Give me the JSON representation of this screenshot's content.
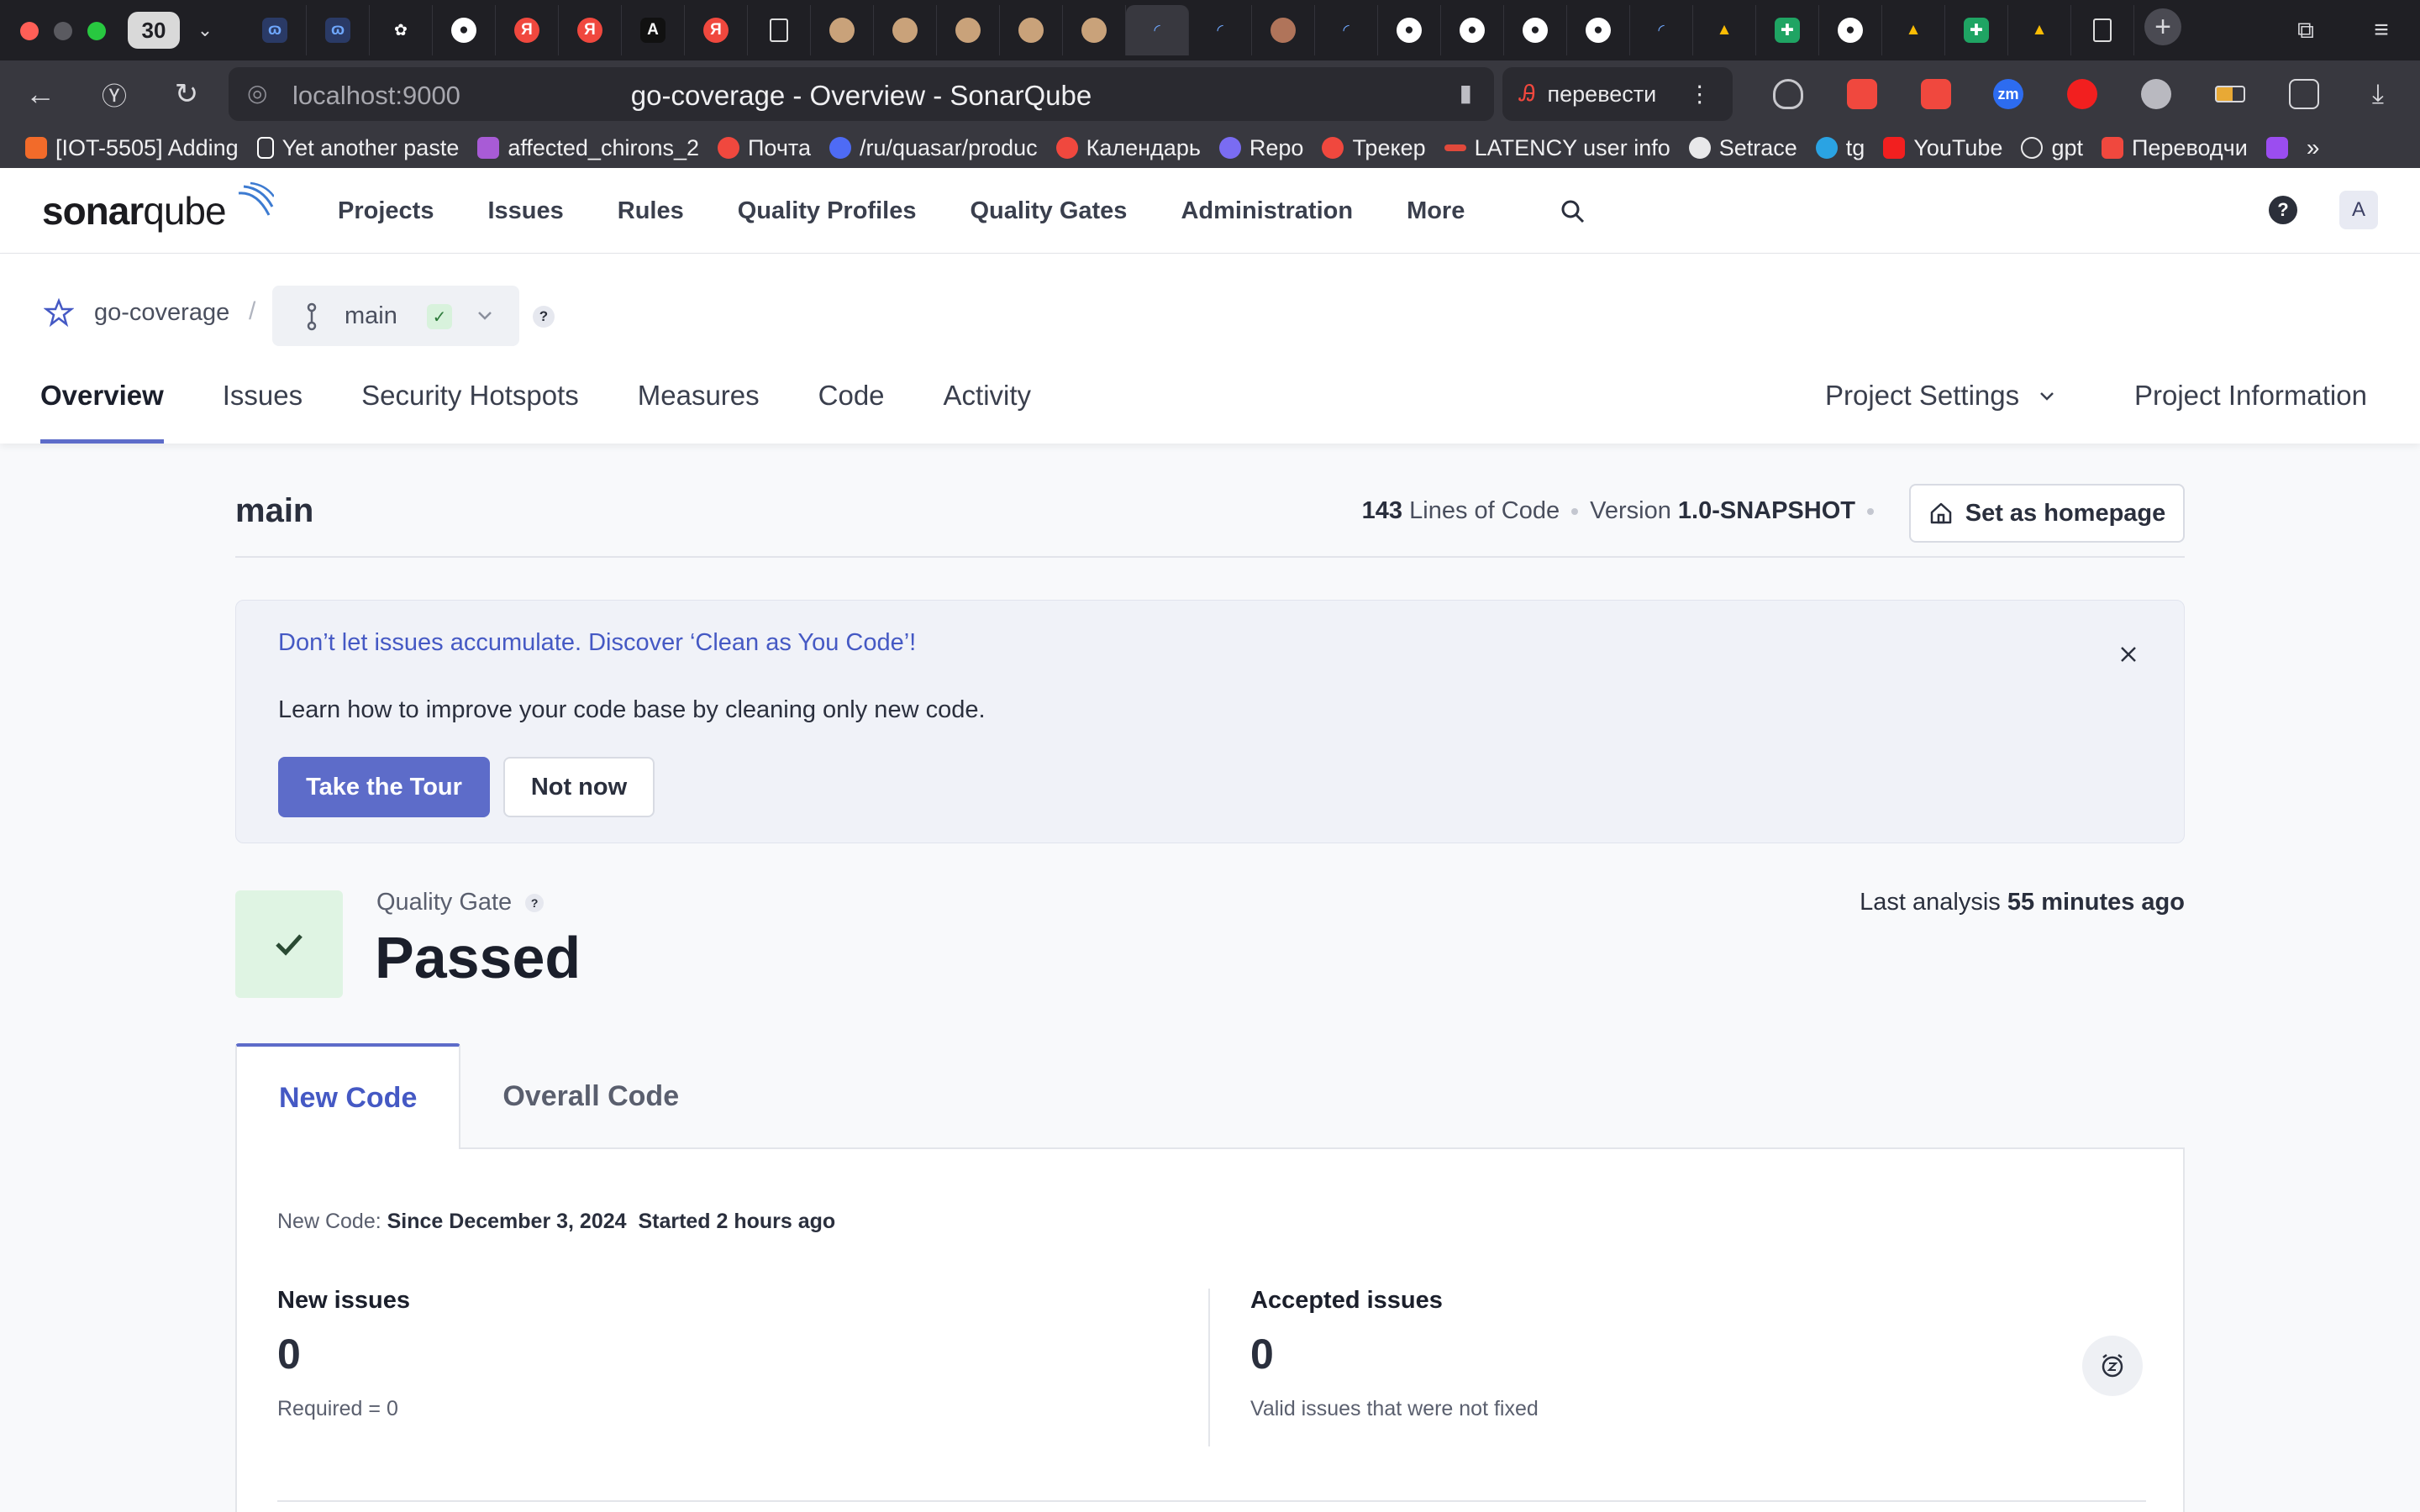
{
  "browser": {
    "tab_count": "30",
    "address": {
      "host": "localhost:9000",
      "page_title": "go-coverage - Overview - SonarQube"
    },
    "translate_label": "перевести",
    "bookmarks": [
      {
        "label": "[IOT-5505] Adding",
        "color": "#f26b2a"
      },
      {
        "label": "Yet another paste",
        "color": "#ffffff"
      },
      {
        "label": "affected_chirons_2",
        "color": "#a85bd6"
      },
      {
        "label": "Почта",
        "color": "#f0483e"
      },
      {
        "label": "/ru/quasar/produc",
        "color": "#4e6bf5"
      },
      {
        "label": "Календарь",
        "color": "#f0483e"
      },
      {
        "label": "Repo",
        "color": "#7a6cf2"
      },
      {
        "label": "Трекер",
        "color": "#f0483e"
      },
      {
        "label": "LATENCY user info",
        "color": "#e0493b"
      },
      {
        "label": "Setrace",
        "color": "#e8e8ea"
      },
      {
        "label": "tg",
        "color": "#2aa3e3"
      },
      {
        "label": "YouTube",
        "color": "#f21f1f"
      },
      {
        "label": "gpt",
        "color": "#e8e8ea"
      },
      {
        "label": "Переводчи",
        "color": "#f0483e"
      }
    ]
  },
  "app": {
    "logo": {
      "bold": "sonar",
      "light": "qube"
    },
    "nav": [
      "Projects",
      "Issues",
      "Rules",
      "Quality Profiles",
      "Quality Gates",
      "Administration",
      "More"
    ],
    "help": "?",
    "avatar": "A"
  },
  "project": {
    "name": "go-coverage",
    "separator": "/",
    "branch": "main",
    "branch_help": "?",
    "tabs": [
      "Overview",
      "Issues",
      "Security Hotspots",
      "Measures",
      "Code",
      "Activity"
    ],
    "settings_label": "Project Settings",
    "info_label": "Project Information"
  },
  "overview": {
    "branch_title": "main",
    "lines_of_code_value": "143",
    "lines_of_code_label": "Lines of Code",
    "version_label": "Version",
    "version_value": "1.0-SNAPSHOT",
    "homepage_button": "Set as homepage",
    "banner": {
      "link": "Don’t let issues accumulate. Discover ‘Clean as You Code’!",
      "text": "Learn how to improve your code base by cleaning only new code.",
      "primary_button": "Take the Tour",
      "secondary_button": "Not now"
    },
    "quality_gate": {
      "label": "Quality Gate",
      "help": "?",
      "status": "Passed",
      "status_color": "#dff4e3"
    },
    "last_analysis_label": "Last analysis",
    "last_analysis_value": "55 minutes ago",
    "code_tabs": [
      "New Code",
      "Overall Code"
    ],
    "new_code": {
      "label": "New Code:",
      "since": "Since December 3, 2024",
      "started": "Started 2 hours ago"
    },
    "new_issues": {
      "label": "New issues",
      "value": "0",
      "sub": "Required = 0"
    },
    "accepted_issues": {
      "label": "Accepted issues",
      "value": "0",
      "sub": "Valid issues that were not fixed"
    }
  },
  "colors": {
    "accent": "#5d6cc9",
    "link": "#4559c4",
    "passed_bg": "#dff4e3",
    "passed_check": "#2d7a3a"
  }
}
